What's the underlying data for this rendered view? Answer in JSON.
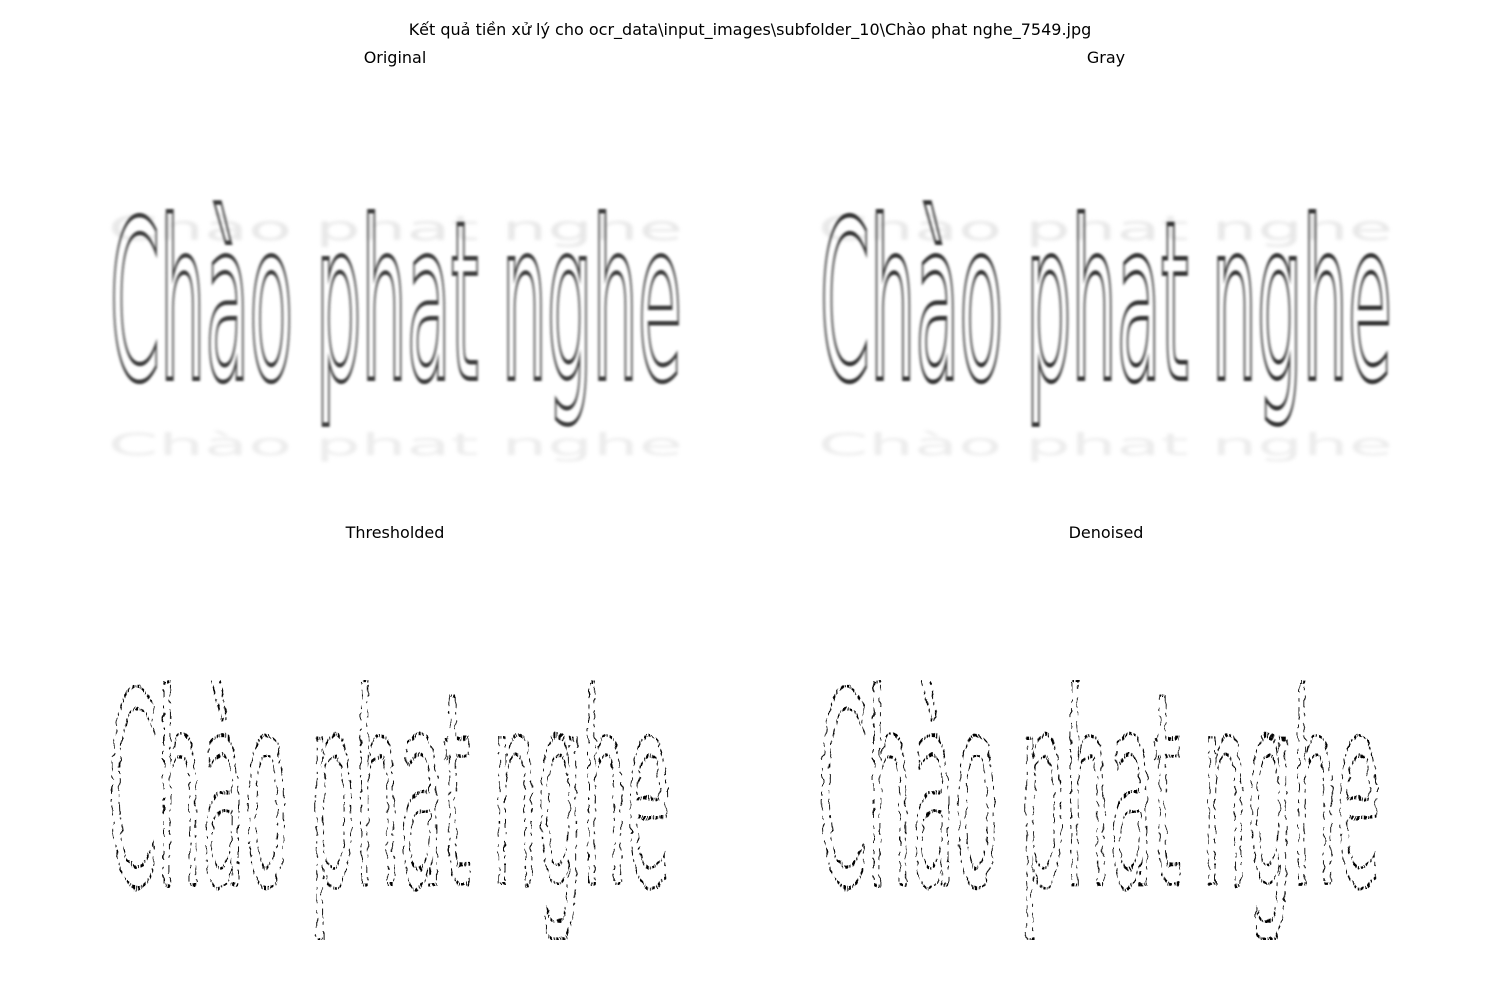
{
  "figure": {
    "suptitle": "Kết quả tiền xử lý cho ocr_data\\input_images\\subfolder_10\\Chào phat nghe_7549.jpg"
  },
  "panels": [
    {
      "title": "Original",
      "text": "Chào phat nghe",
      "style": "blurred-grayscale"
    },
    {
      "title": "Gray",
      "text": "Chào phat nghe",
      "style": "blurred-grayscale"
    },
    {
      "title": "Thresholded",
      "text": "Chào phat nghe",
      "style": "binary-speckled"
    },
    {
      "title": "Denoised",
      "text": "Chào phat nghe",
      "style": "binary-speckled"
    }
  ],
  "colors": {
    "background": "#ffffff",
    "ink": "#000000",
    "soft_ink": "#3a3a3a",
    "ghost": "#d6d6d6"
  }
}
